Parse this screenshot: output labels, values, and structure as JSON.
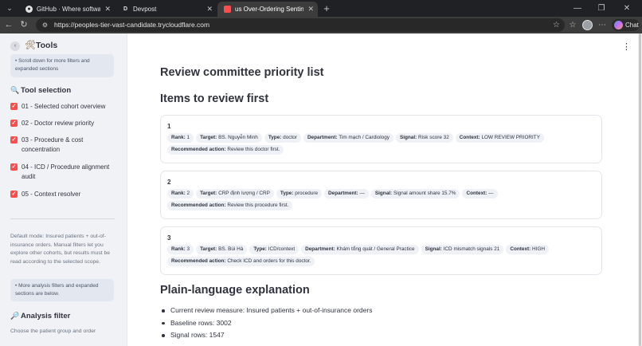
{
  "browser": {
    "tabs": [
      {
        "title": "GitHub · Where software is built",
        "favicon": "github-icon"
      },
      {
        "title": "Devpost",
        "favicon": "devpost-icon",
        "favicon_letter": "D"
      },
      {
        "title": "us Over-Ordering Sentinel",
        "favicon": "app-icon",
        "active": true
      }
    ],
    "url": "https://peoples-tier-vast-candidate.trycloudflare.com",
    "chat_label": "Chat"
  },
  "sidebar": {
    "tools_title": "Tools",
    "scroll_hint": "• Scroll down for more filters and expanded sections",
    "tool_selection_title": "Tool selection",
    "items": [
      {
        "label": "01 - Selected cohort overview",
        "checked": true
      },
      {
        "label": "02 - Doctor review priority",
        "checked": true
      },
      {
        "label": "03 - Procedure & cost concentration",
        "checked": true
      },
      {
        "label": "04 - ICD / Procedure alignment audit",
        "checked": true
      },
      {
        "label": "05 - Context resolver",
        "checked": true
      }
    ],
    "mode_text": "Default mode: Insured patients + out-of-insurance orders. Manual filters let you explore other cohorts, but results must be read according to the selected scope.",
    "more_hint": "• More analysis filters and expanded sections are below.",
    "analysis_filter_title": "Analysis filter",
    "choose_text": "Choose the patient group and order"
  },
  "main": {
    "heading_list": "Review committee priority list",
    "heading_items": "Items to review first",
    "cards": [
      {
        "rank_num": "1",
        "rank": "1",
        "target": "BS. Nguyễn Minh",
        "type": "doctor",
        "department": "Tim mạch / Cardiology",
        "signal": "Risk score 32",
        "context": "LOW REVIEW PRIORITY",
        "action": "Review this doctor first."
      },
      {
        "rank_num": "2",
        "rank": "2",
        "target": "CRP định lượng / CRP",
        "type": "procedure",
        "department": "—",
        "signal": "Signal amount share 15.7%",
        "context": "—",
        "action": "Review this procedure first."
      },
      {
        "rank_num": "3",
        "rank": "3",
        "target": "BS. Bùi Hà",
        "type": "ICD/context",
        "department": "Khám tổng quát / General Practice",
        "signal": "ICD mismatch signals 21",
        "context": "HIGH",
        "action": "Check ICD and orders for this doctor."
      }
    ],
    "labels": {
      "rank": "Rank:",
      "target": "Target:",
      "type": "Type:",
      "department": "Department:",
      "signal": "Signal:",
      "context": "Context:",
      "action": "Recommended action:"
    },
    "heading_plain": "Plain-language explanation",
    "bullets": [
      "Current review measure: Insured patients + out-of-insurance orders",
      "Baseline rows: 3002",
      "Signal rows: 1547"
    ]
  }
}
